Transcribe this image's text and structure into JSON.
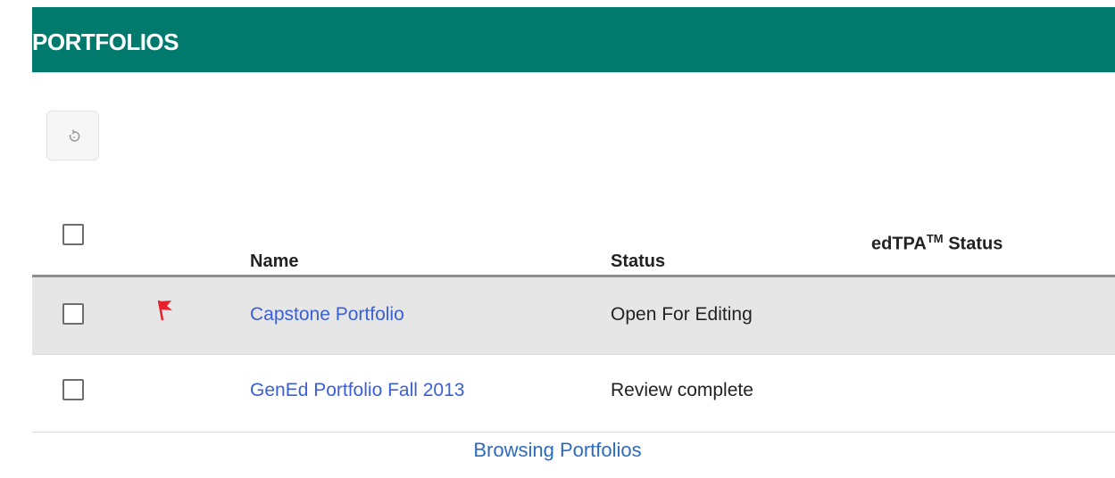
{
  "header": {
    "title": "PORTFOLIOS",
    "background": "#007a6c"
  },
  "toolbar": {
    "refresh_icon": "refresh-icon"
  },
  "table": {
    "columns": {
      "name": "Name",
      "status": "Status",
      "edtpa": "edTPA",
      "edtpa_sup": "TM",
      "edtpa_suffix": " Status"
    },
    "rows": [
      {
        "name": "Capstone Portfolio",
        "status": "Open For Editing",
        "flagged": true
      },
      {
        "name": "GenEd Portfolio Fall 2013",
        "status": "Review complete",
        "flagged": false
      }
    ]
  },
  "caption": "Browsing Portfolios",
  "colors": {
    "link": "#3a5fd6",
    "flag": "#e8202b",
    "caption": "#2d6bbf"
  }
}
